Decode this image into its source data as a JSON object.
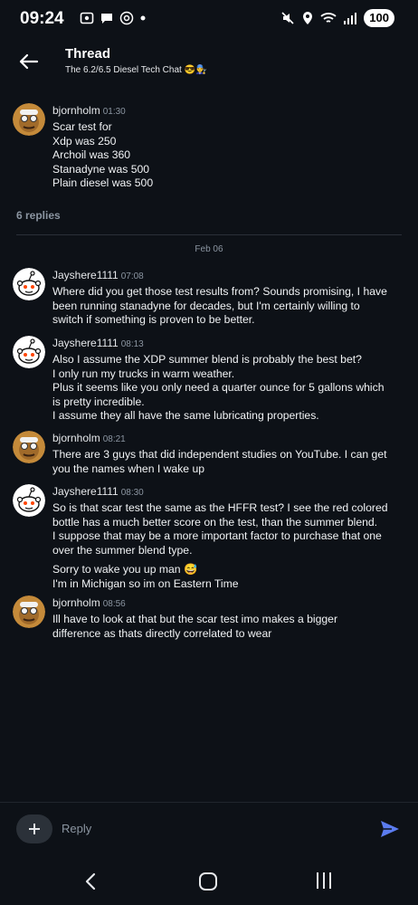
{
  "status_bar": {
    "time": "09:24",
    "battery": "100",
    "icons_left": [
      "screenshot-icon",
      "chat-bubble-icon",
      "threads-icon",
      "dot-icon"
    ],
    "icons_right": [
      "mute-icon",
      "location-icon",
      "wifi-icon",
      "signal-icon"
    ]
  },
  "header": {
    "title": "Thread",
    "subtitle": "The 6.2/6.5 Diesel Tech Chat 😎👨‍🔧"
  },
  "parent_message": {
    "username": "bjornholm",
    "time": "01:30",
    "lines": [
      "Scar test for",
      "Xdp was 250",
      "Archoil was 360",
      "Stanadyne was 500",
      "Plain diesel was 500"
    ]
  },
  "replies_count": "6 replies",
  "date_separator": "Feb 06",
  "replies": [
    {
      "username": "Jayshere1111",
      "time": "07:08",
      "avatar": "reddit-snoo",
      "paragraphs": [
        [
          "Where did you get those test results from?  Sounds promising, I have",
          "been running stanadyne for decades, but I'm certainly willing to",
          "switch if something is proven to be better."
        ]
      ]
    },
    {
      "username": "Jayshere1111",
      "time": "08:13",
      "avatar": "reddit-snoo",
      "paragraphs": [
        [
          "Also I assume the XDP summer blend is probably the best bet?",
          "I only run my trucks in warm weather.",
          "Plus it seems like you only need a quarter ounce for 5 gallons which",
          "is pretty incredible.",
          "I assume they all have the same lubricating properties."
        ]
      ]
    },
    {
      "username": "bjornholm",
      "time": "08:21",
      "avatar": "bjornholm",
      "paragraphs": [
        [
          "There are 3 guys that did independent studies on YouTube. I can get",
          "you the names when I wake up"
        ]
      ]
    },
    {
      "username": "Jayshere1111",
      "time": "08:30",
      "avatar": "reddit-snoo",
      "paragraphs": [
        [
          "So is that scar test the same as the HFFR test?   I see the red colored",
          "bottle has a much better score on the test, than the summer blend.",
          "I suppose that may be a more important factor to purchase that one",
          "over the summer blend type."
        ],
        [
          "Sorry to wake you up man 😅",
          "I'm in Michigan so im on Eastern Time"
        ]
      ]
    },
    {
      "username": "bjornholm",
      "time": "08:56",
      "avatar": "bjornholm",
      "paragraphs": [
        [
          "Ill have to look at that but the scar test imo makes a bigger",
          "difference as thats directly correlated to wear"
        ]
      ]
    }
  ],
  "composer": {
    "placeholder": "Reply"
  },
  "colors": {
    "background": "#0d1117",
    "send_accent": "#5b7cf0",
    "muted_text": "#8b95a1"
  }
}
